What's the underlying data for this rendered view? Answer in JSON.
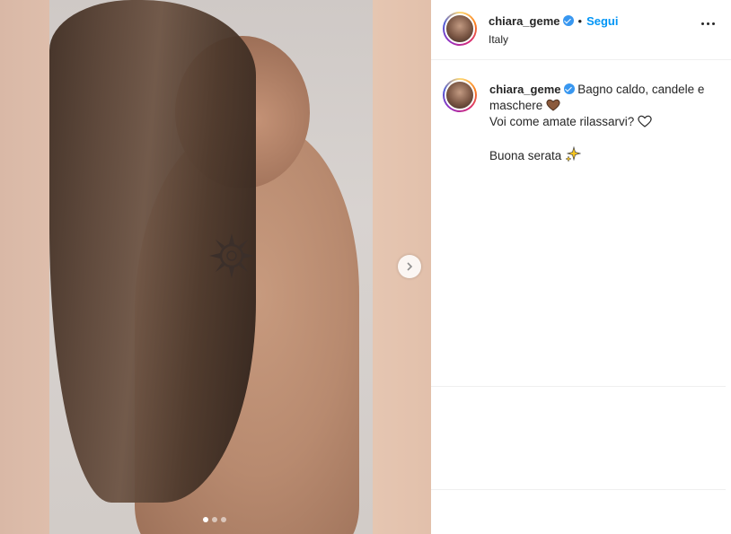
{
  "post": {
    "username": "chiara_geme",
    "separator": "•",
    "follow_label": "Segui",
    "location": "Italy",
    "caption": {
      "line1": "Bagno caldo, candele e",
      "line2": "maschere",
      "line3": "Voi come amate rilassarvi?",
      "line4": "Buona serata"
    },
    "carousel": {
      "total_slides": 3,
      "current_slide": 1
    }
  },
  "icons": {
    "verified": "verified-badge-icon",
    "more": "more-options-icon",
    "next": "chevron-right-icon",
    "brown_heart": "brown-heart-emoji",
    "white_heart": "white-heart-emoji",
    "sparkles": "sparkles-emoji"
  },
  "colors": {
    "link_blue": "#0095f6",
    "verified_blue": "#3897f0",
    "text": "#262626",
    "border": "#efefef"
  }
}
